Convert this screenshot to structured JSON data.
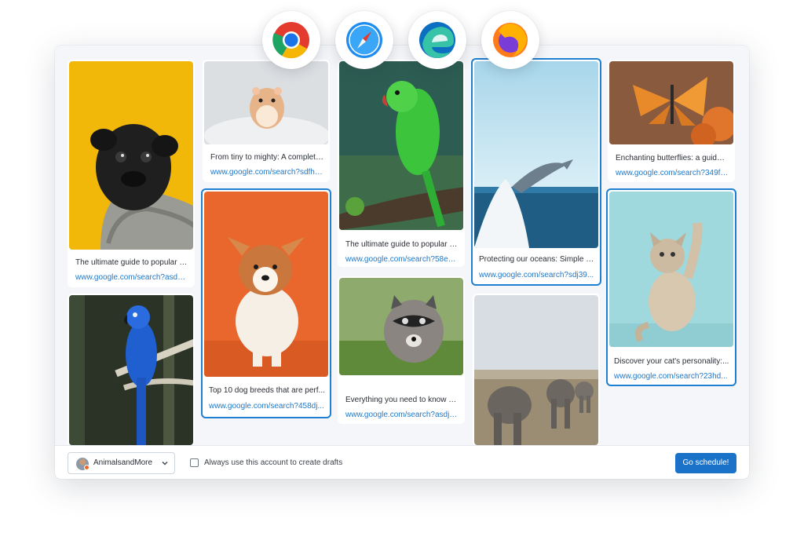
{
  "browsers": [
    {
      "name": "chrome-icon"
    },
    {
      "name": "safari-icon"
    },
    {
      "name": "edge-icon"
    },
    {
      "name": "firefox-icon"
    }
  ],
  "pins": [
    {
      "title": "The ultimate guide to popular do...",
      "link": "www.google.com/search?asds4...",
      "image": "pug-photo"
    },
    {
      "title": "",
      "link": "",
      "image": "blue-parrot-photo"
    },
    {
      "title": "From tiny to mighty: A complete...",
      "link": "www.google.com/search?sdfh9...",
      "image": "hamster-photo"
    },
    {
      "title": "Top 10 dog breeds that are perf...",
      "link": "www.google.com/search?458dj...",
      "image": "corgi-puppy-photo"
    },
    {
      "title": "The ultimate guide to popular do...",
      "link": "www.google.com/search?58ede...",
      "image": "green-parrot-photo"
    },
    {
      "title": "Everything you need to know ab...",
      "link": "www.google.com/search?asdj2...",
      "image": "raccoon-photo"
    },
    {
      "title": "Protecting our oceans: Simple w...",
      "link": "www.google.com/search?sdj39...",
      "image": "dolphin-photo"
    },
    {
      "title": "",
      "link": "",
      "image": "elephants-photo"
    },
    {
      "title": "Enchanting butterflies: a guide t...",
      "link": "www.google.com/search?349fjs...",
      "image": "butterfly-photo"
    },
    {
      "title": "Discover your cat's personality:...",
      "link": "www.google.com/search?23hd...",
      "image": "kitten-photo"
    }
  ],
  "footer": {
    "account_name": "AnimalsandMore",
    "checkbox_label": "Always use this account to create drafts",
    "schedule_button": "Go schedule!"
  },
  "colors": {
    "accent": "#1a73c9",
    "link": "#1f78c8",
    "selected_border": "#1f7fd1"
  }
}
